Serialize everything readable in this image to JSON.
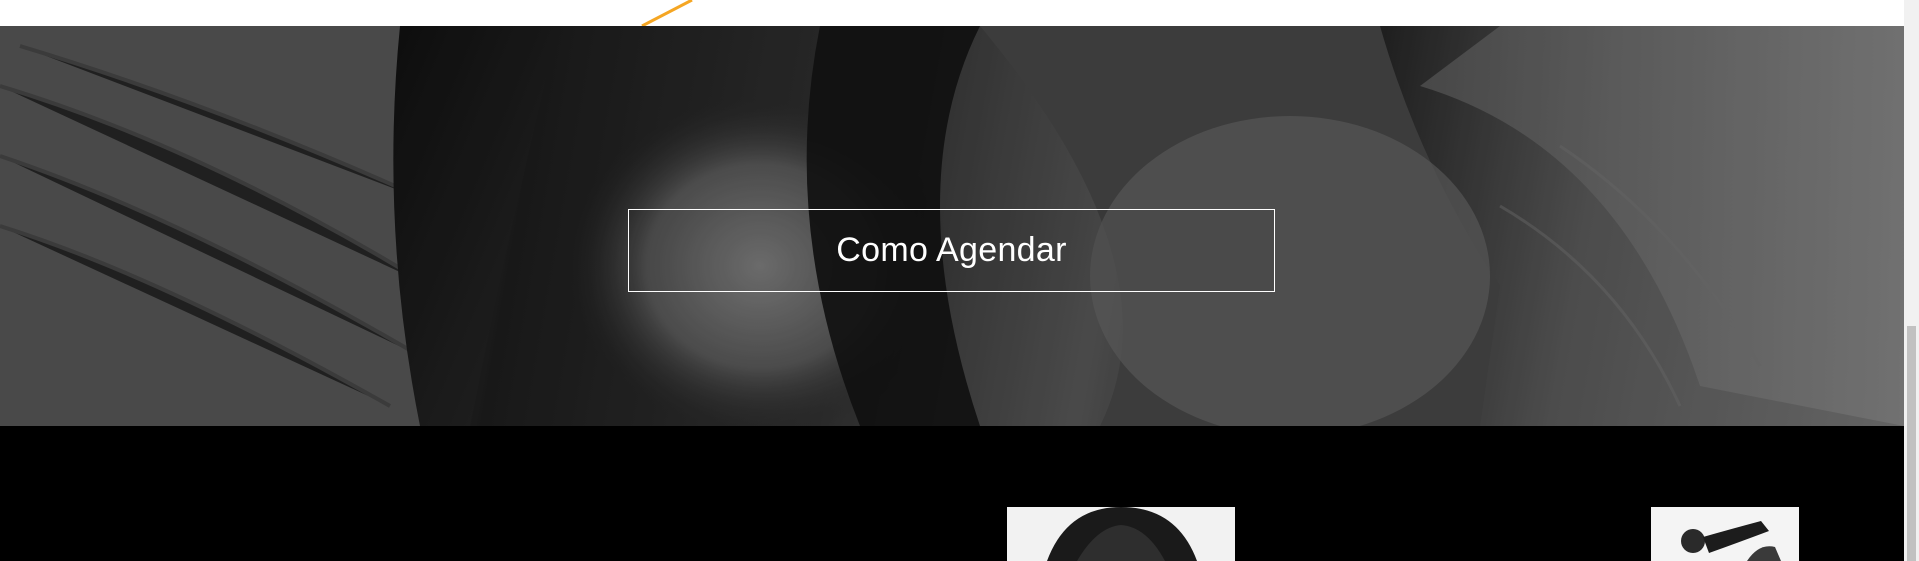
{
  "hero": {
    "cta_label": "Como Agendar",
    "image_icon": "portrait-photo-grayscale"
  },
  "thumbnails": [
    {
      "icon": "portrait-photo"
    },
    {
      "icon": "portrait-photo"
    }
  ],
  "colors": {
    "accent": "#f5a623",
    "top_background": "#ffffff",
    "section_background": "#000000",
    "cta_border": "#ffffff",
    "cta_text": "#ffffff",
    "scrollbar_track": "#f1f1f1",
    "scrollbar_thumb": "#c1c1c1"
  }
}
